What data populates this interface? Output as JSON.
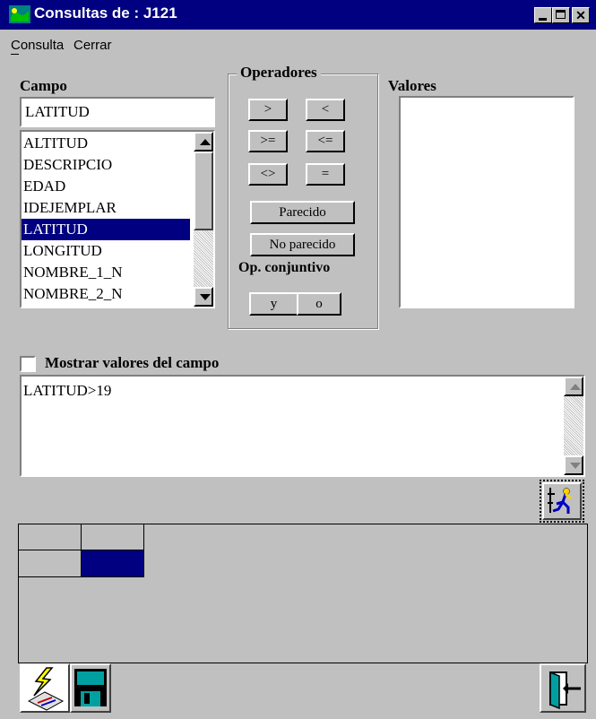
{
  "window": {
    "title": "Consultas de : J121"
  },
  "menu": {
    "items": [
      "Consulta",
      "Cerrar"
    ]
  },
  "campo": {
    "label": "Campo",
    "value": "LATITUD",
    "list": [
      "ALTITUD",
      "DESCRIPCIO",
      "EDAD",
      "IDEJEMPLAR",
      "LATITUD",
      "LONGITUD",
      "NOMBRE_1_N",
      "NOMBRE_2_N"
    ],
    "selected": "LATITUD"
  },
  "operadores": {
    "label": "Operadores",
    "gt": ">",
    "lt": "<",
    "ge": ">=",
    "le": "<=",
    "ne": "<>",
    "eq": "=",
    "parecido": "Parecido",
    "no_parecido": "No parecido",
    "conj_label": "Op. conjuntivo",
    "y": "y",
    "o": "o"
  },
  "valores": {
    "label": "Valores"
  },
  "mostrar": {
    "label": "Mostrar valores del campo",
    "checked": false
  },
  "query": {
    "text": "LATITUD>19"
  },
  "icons": {
    "run": "run-query-icon",
    "execute": "lightning-icon",
    "save": "floppy-disk-icon",
    "exit": "exit-door-icon"
  },
  "colors": {
    "titlebar": "#000080",
    "selection": "#000080",
    "face": "#c0c0c0"
  }
}
